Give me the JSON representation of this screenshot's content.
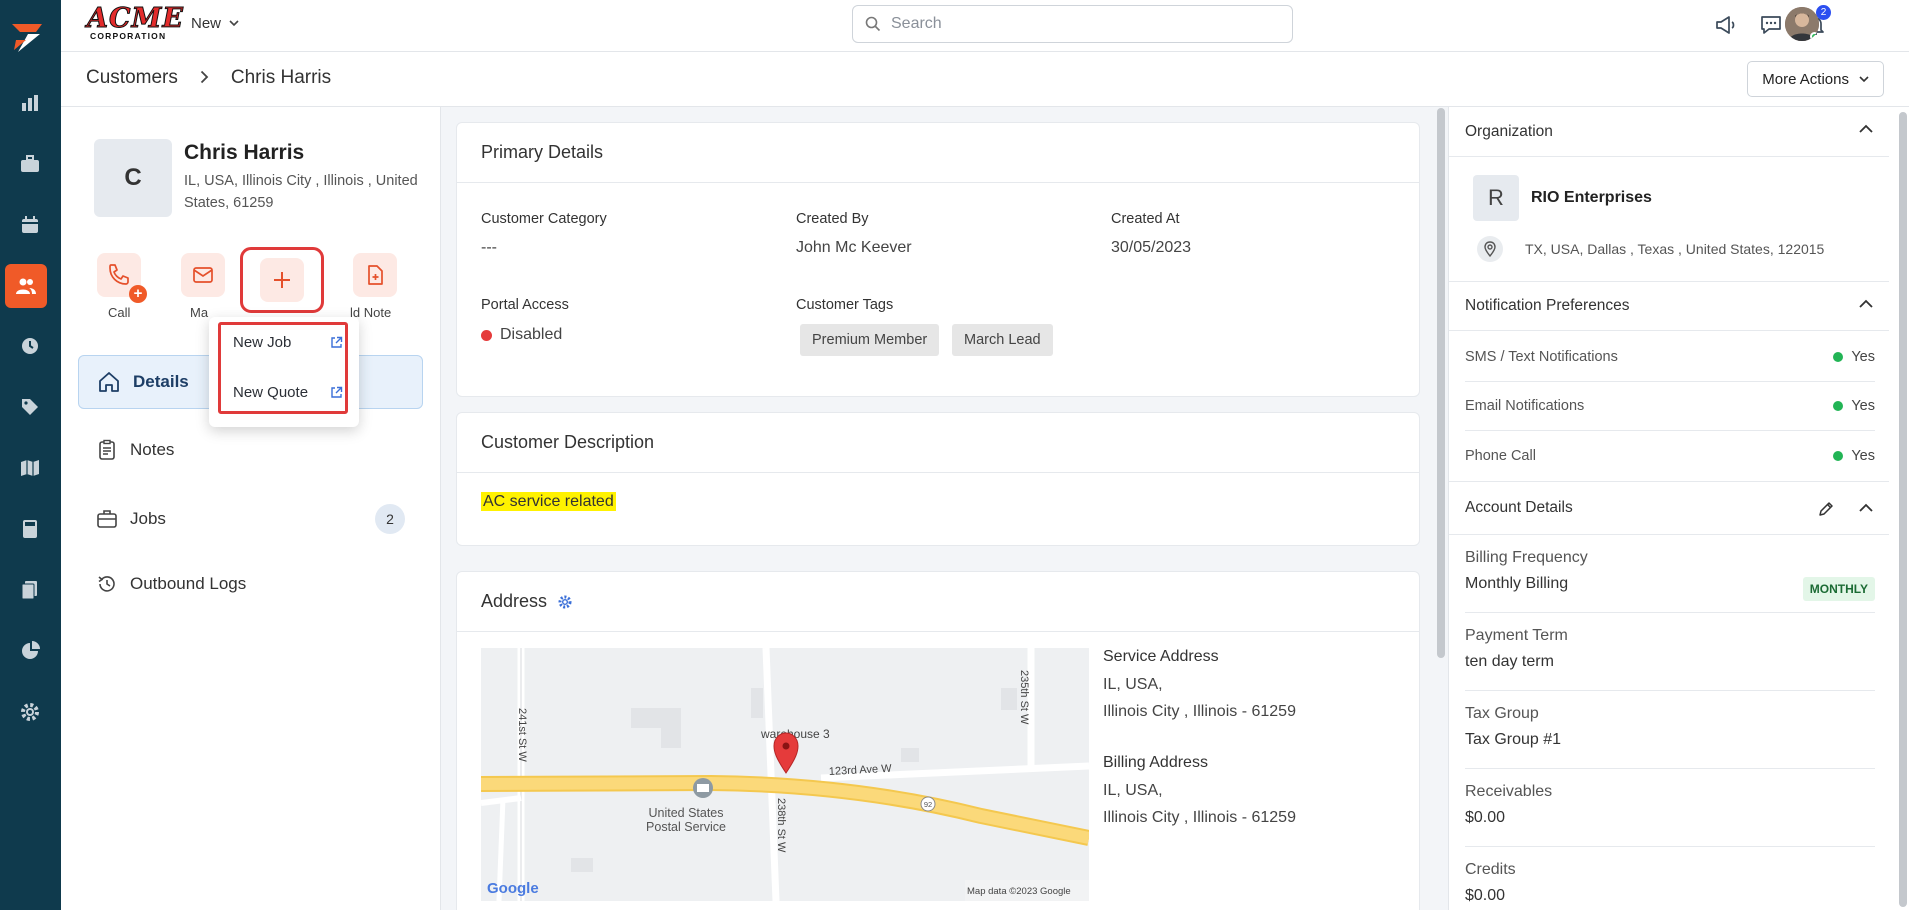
{
  "topbar": {
    "brand_name": "ACME",
    "brand_sub": "CORPORATION",
    "new_label": "New",
    "search_placeholder": "Search",
    "notification_count": "2"
  },
  "breadcrumb": {
    "root": "Customers",
    "current": "Chris Harris"
  },
  "more_actions_label": "More Actions",
  "customer": {
    "initial": "C",
    "name": "Chris Harris",
    "address": "IL, USA, Illinois City , Illinois , United States, 61259"
  },
  "quick_actions": {
    "call": "Call",
    "mail": "Ma",
    "add_note": "ld Note"
  },
  "add_menu": {
    "items": [
      "New Job",
      "New Quote"
    ]
  },
  "nav": {
    "details": "Details",
    "notes": "Notes",
    "jobs": "Jobs",
    "jobs_count": "2",
    "outbound_logs": "Outbound Logs"
  },
  "primary_details": {
    "title": "Primary Details",
    "customer_category_label": "Customer Category",
    "customer_category_value": "---",
    "created_by_label": "Created By",
    "created_by_value": "John Mc Keever",
    "created_at_label": "Created At",
    "created_at_value": "30/05/2023",
    "portal_access_label": "Portal Access",
    "portal_access_value": "Disabled",
    "customer_tags_label": "Customer Tags",
    "tags": [
      "Premium Member",
      "March Lead"
    ]
  },
  "customer_description": {
    "title": "Customer Description",
    "text": "AC service related"
  },
  "address": {
    "title": "Address",
    "service_label": "Service Address",
    "service_line1": "IL, USA,",
    "service_line2": "Illinois City , Illinois - 61259",
    "billing_label": "Billing Address",
    "billing_line1": "IL, USA,",
    "billing_line2": "Illinois City , Illinois - 61259",
    "map": {
      "labels": {
        "warehouse": "warehouse 3",
        "ave": "123rd Ave W",
        "usps1": "United States",
        "usps2": "Postal Service",
        "st241": "241st St W",
        "st235": "235th St W",
        "st238": "238th St W",
        "route": "92",
        "google": "Google",
        "map_data": "Map data ©2023 Google"
      }
    }
  },
  "organization": {
    "title": "Organization",
    "initial": "R",
    "name": "RIO Enterprises",
    "address": "TX, USA, Dallas , Texas , United States, 122015"
  },
  "notification_preferences": {
    "title": "Notification Preferences",
    "rows": [
      {
        "label": "SMS / Text Notifications",
        "value": "Yes"
      },
      {
        "label": "Email Notifications",
        "value": "Yes"
      },
      {
        "label": "Phone Call",
        "value": "Yes"
      }
    ]
  },
  "account_details": {
    "title": "Account Details",
    "billing_frequency_label": "Billing Frequency",
    "billing_frequency_value": "Monthly Billing",
    "billing_badge": "MONTHLY",
    "payment_term_label": "Payment Term",
    "payment_term_value": "ten day term",
    "tax_group_label": "Tax Group",
    "tax_group_value": "Tax Group #1",
    "receivables_label": "Receivables",
    "receivables_value": "$0.00",
    "credits_label": "Credits",
    "credits_value": "$0.00"
  },
  "colors": {
    "rail": "#0f3a4d",
    "accent": "#f05a28",
    "highlight_box": "#e03a3a",
    "success": "#22b455",
    "danger": "#e53b3b"
  },
  "icons": {
    "rail": [
      "logo-icon",
      "reports-icon",
      "briefcase-icon",
      "calendar-icon",
      "customers-icon",
      "clock-icon",
      "tag-icon",
      "map-icon",
      "calculator-icon",
      "documents-icon",
      "pie-chart-icon",
      "settings-icon"
    ]
  }
}
